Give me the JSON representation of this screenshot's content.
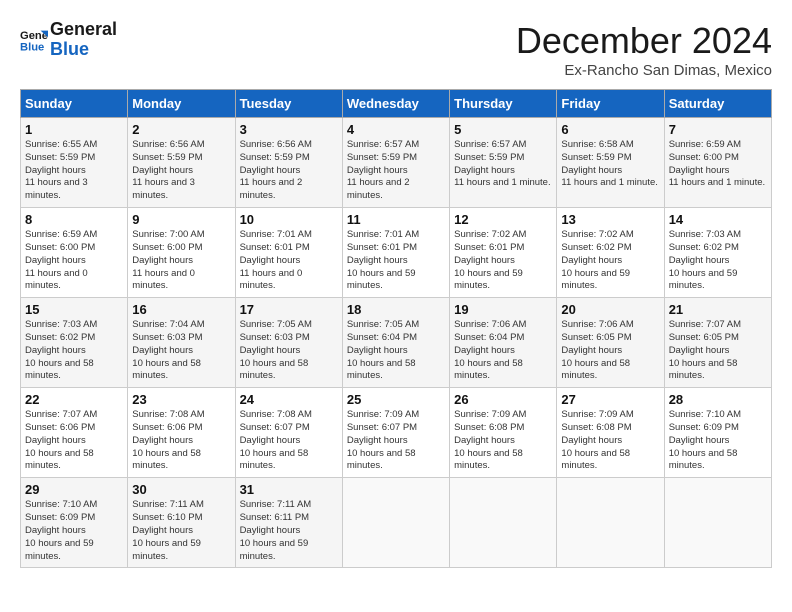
{
  "logo": {
    "line1": "General",
    "line2": "Blue"
  },
  "title": "December 2024",
  "location": "Ex-Rancho San Dimas, Mexico",
  "days_of_week": [
    "Sunday",
    "Monday",
    "Tuesday",
    "Wednesday",
    "Thursday",
    "Friday",
    "Saturday"
  ],
  "weeks": [
    [
      {
        "day": "1",
        "sunrise": "6:55 AM",
        "sunset": "5:59 PM",
        "daylight": "11 hours and 3 minutes."
      },
      {
        "day": "2",
        "sunrise": "6:56 AM",
        "sunset": "5:59 PM",
        "daylight": "11 hours and 3 minutes."
      },
      {
        "day": "3",
        "sunrise": "6:56 AM",
        "sunset": "5:59 PM",
        "daylight": "11 hours and 2 minutes."
      },
      {
        "day": "4",
        "sunrise": "6:57 AM",
        "sunset": "5:59 PM",
        "daylight": "11 hours and 2 minutes."
      },
      {
        "day": "5",
        "sunrise": "6:57 AM",
        "sunset": "5:59 PM",
        "daylight": "11 hours and 1 minute."
      },
      {
        "day": "6",
        "sunrise": "6:58 AM",
        "sunset": "5:59 PM",
        "daylight": "11 hours and 1 minute."
      },
      {
        "day": "7",
        "sunrise": "6:59 AM",
        "sunset": "6:00 PM",
        "daylight": "11 hours and 1 minute."
      }
    ],
    [
      {
        "day": "8",
        "sunrise": "6:59 AM",
        "sunset": "6:00 PM",
        "daylight": "11 hours and 0 minutes."
      },
      {
        "day": "9",
        "sunrise": "7:00 AM",
        "sunset": "6:00 PM",
        "daylight": "11 hours and 0 minutes."
      },
      {
        "day": "10",
        "sunrise": "7:01 AM",
        "sunset": "6:01 PM",
        "daylight": "11 hours and 0 minutes."
      },
      {
        "day": "11",
        "sunrise": "7:01 AM",
        "sunset": "6:01 PM",
        "daylight": "10 hours and 59 minutes."
      },
      {
        "day": "12",
        "sunrise": "7:02 AM",
        "sunset": "6:01 PM",
        "daylight": "10 hours and 59 minutes."
      },
      {
        "day": "13",
        "sunrise": "7:02 AM",
        "sunset": "6:02 PM",
        "daylight": "10 hours and 59 minutes."
      },
      {
        "day": "14",
        "sunrise": "7:03 AM",
        "sunset": "6:02 PM",
        "daylight": "10 hours and 59 minutes."
      }
    ],
    [
      {
        "day": "15",
        "sunrise": "7:03 AM",
        "sunset": "6:02 PM",
        "daylight": "10 hours and 58 minutes."
      },
      {
        "day": "16",
        "sunrise": "7:04 AM",
        "sunset": "6:03 PM",
        "daylight": "10 hours and 58 minutes."
      },
      {
        "day": "17",
        "sunrise": "7:05 AM",
        "sunset": "6:03 PM",
        "daylight": "10 hours and 58 minutes."
      },
      {
        "day": "18",
        "sunrise": "7:05 AM",
        "sunset": "6:04 PM",
        "daylight": "10 hours and 58 minutes."
      },
      {
        "day": "19",
        "sunrise": "7:06 AM",
        "sunset": "6:04 PM",
        "daylight": "10 hours and 58 minutes."
      },
      {
        "day": "20",
        "sunrise": "7:06 AM",
        "sunset": "6:05 PM",
        "daylight": "10 hours and 58 minutes."
      },
      {
        "day": "21",
        "sunrise": "7:07 AM",
        "sunset": "6:05 PM",
        "daylight": "10 hours and 58 minutes."
      }
    ],
    [
      {
        "day": "22",
        "sunrise": "7:07 AM",
        "sunset": "6:06 PM",
        "daylight": "10 hours and 58 minutes."
      },
      {
        "day": "23",
        "sunrise": "7:08 AM",
        "sunset": "6:06 PM",
        "daylight": "10 hours and 58 minutes."
      },
      {
        "day": "24",
        "sunrise": "7:08 AM",
        "sunset": "6:07 PM",
        "daylight": "10 hours and 58 minutes."
      },
      {
        "day": "25",
        "sunrise": "7:09 AM",
        "sunset": "6:07 PM",
        "daylight": "10 hours and 58 minutes."
      },
      {
        "day": "26",
        "sunrise": "7:09 AM",
        "sunset": "6:08 PM",
        "daylight": "10 hours and 58 minutes."
      },
      {
        "day": "27",
        "sunrise": "7:09 AM",
        "sunset": "6:08 PM",
        "daylight": "10 hours and 58 minutes."
      },
      {
        "day": "28",
        "sunrise": "7:10 AM",
        "sunset": "6:09 PM",
        "daylight": "10 hours and 58 minutes."
      }
    ],
    [
      {
        "day": "29",
        "sunrise": "7:10 AM",
        "sunset": "6:09 PM",
        "daylight": "10 hours and 59 minutes."
      },
      {
        "day": "30",
        "sunrise": "7:11 AM",
        "sunset": "6:10 PM",
        "daylight": "10 hours and 59 minutes."
      },
      {
        "day": "31",
        "sunrise": "7:11 AM",
        "sunset": "6:11 PM",
        "daylight": "10 hours and 59 minutes."
      },
      null,
      null,
      null,
      null
    ]
  ]
}
